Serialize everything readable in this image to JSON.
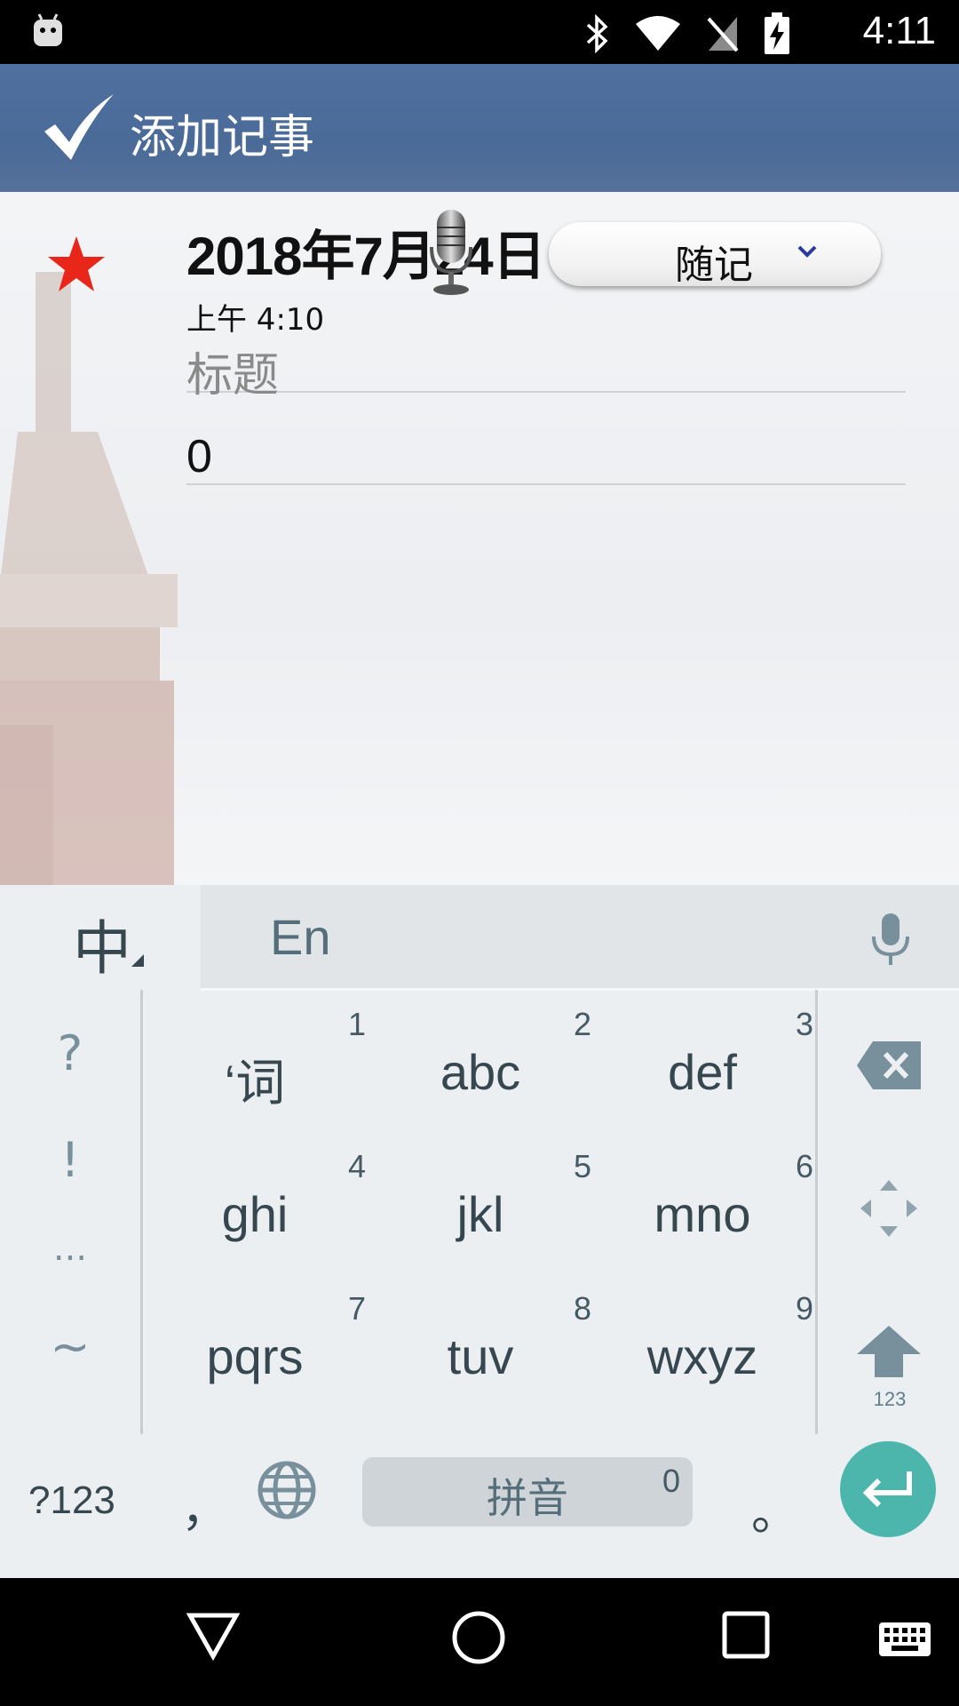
{
  "status_bar": {
    "time": "4:11",
    "icons": [
      "android-icon",
      "bluetooth-icon",
      "wifi-icon",
      "no-sim-icon",
      "battery-charging-icon"
    ]
  },
  "action_bar": {
    "title": "添加记事",
    "confirm_icon": "checkmark-icon"
  },
  "note": {
    "starred": true,
    "date": "2018年7月24日",
    "time": "上午 4:10",
    "category": "随记",
    "title_placeholder": "标题",
    "title_value": "",
    "body_value": "0"
  },
  "keyboard": {
    "language_toggle": "中",
    "english_label": "En",
    "left_symbols": [
      "?",
      "!",
      "...",
      "~"
    ],
    "keys": [
      {
        "label": "‘词",
        "num": "1"
      },
      {
        "label": "abc",
        "num": "2"
      },
      {
        "label": "def",
        "num": "3"
      },
      {
        "label": "ghi",
        "num": "4"
      },
      {
        "label": "jkl",
        "num": "5"
      },
      {
        "label": "mno",
        "num": "6"
      },
      {
        "label": "pqrs",
        "num": "7"
      },
      {
        "label": "tuv",
        "num": "8"
      },
      {
        "label": "wxyz",
        "num": "9"
      }
    ],
    "shift_sub_label": "123",
    "symbols_key": "?123",
    "comma": "，",
    "space_label": "拼音",
    "space_num": "0",
    "period": "。"
  },
  "colors": {
    "action_bar": "#4a6a98",
    "star": "#e8261a",
    "enter_key": "#4db6ac",
    "keyboard_bg": "#eceff1"
  }
}
